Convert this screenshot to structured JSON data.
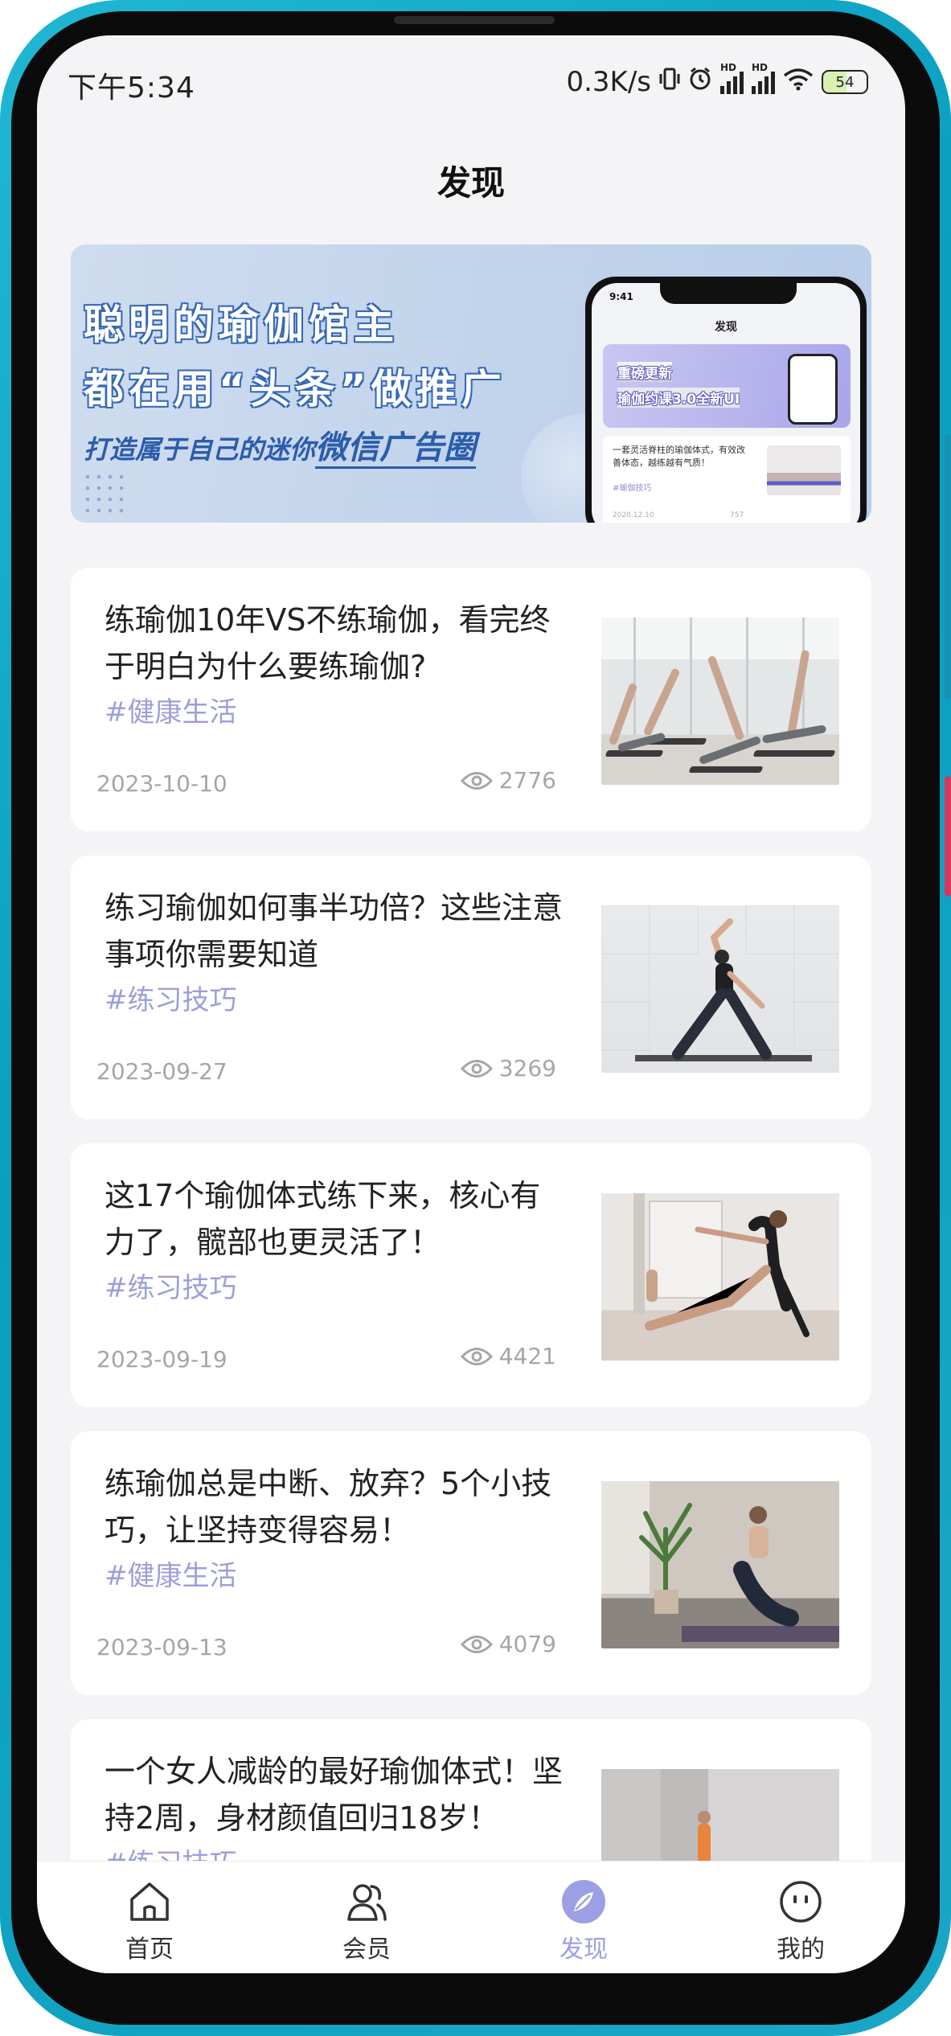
{
  "status_bar": {
    "time": "下午5:34",
    "network_speed": "0.3K/s",
    "battery": "54",
    "icons": [
      "vibrate-icon",
      "alarm-icon",
      "signal-hd-icon",
      "signal-hd-icon",
      "wifi-icon",
      "battery-icon"
    ]
  },
  "header": {
    "title": "发现"
  },
  "banner": {
    "line1": "聪明的瑜伽馆主",
    "line2": "都在用“头条”做推广",
    "line3_prefix": "打造属于自己的迷你",
    "line3_em": "微信广告圈",
    "phone_preview": {
      "time": "9:41",
      "title": "发现",
      "banner_line1": "重磅更新",
      "banner_line2": "瑜伽约课3.0全新UI",
      "card_text": "一套灵活脊柱的瑜伽体式，有效改善体态，越练越有气质！",
      "card_tag": "#瑜伽技巧",
      "card_date": "2020.12.10",
      "card_views": "757"
    }
  },
  "articles": [
    {
      "title": "练瑜伽10年VS不练瑜伽，看完终于明白为什么要练瑜伽?",
      "tag": "#健康生活",
      "date": "2023-10-10",
      "views": "2776"
    },
    {
      "title": "练习瑜伽如何事半功倍？这些注意事项你需要知道",
      "tag": "#练习技巧",
      "date": "2023-09-27",
      "views": "3269"
    },
    {
      "title": "这17个瑜伽体式练下来，核心有力了，髋部也更灵活了！",
      "tag": "#练习技巧",
      "date": "2023-09-19",
      "views": "4421"
    },
    {
      "title": "练瑜伽总是中断、放弃？5个小技巧，让坚持变得容易！",
      "tag": "#健康生活",
      "date": "2023-09-13",
      "views": "4079"
    },
    {
      "title": "一个女人减龄的最好瑜伽体式！坚持2周，身材颜值回归18岁！",
      "tag": "#练习技巧",
      "date": "",
      "views": ""
    }
  ],
  "tabbar": {
    "items": [
      {
        "label": "首页",
        "icon": "home-icon"
      },
      {
        "label": "会员",
        "icon": "members-icon"
      },
      {
        "label": "发现",
        "icon": "discover-icon",
        "active": true
      },
      {
        "label": "我的",
        "icon": "profile-icon"
      }
    ]
  },
  "colors": {
    "accent": "#9c9fe4",
    "tag": "#9d9fd8",
    "background": "#f4f4f6"
  }
}
